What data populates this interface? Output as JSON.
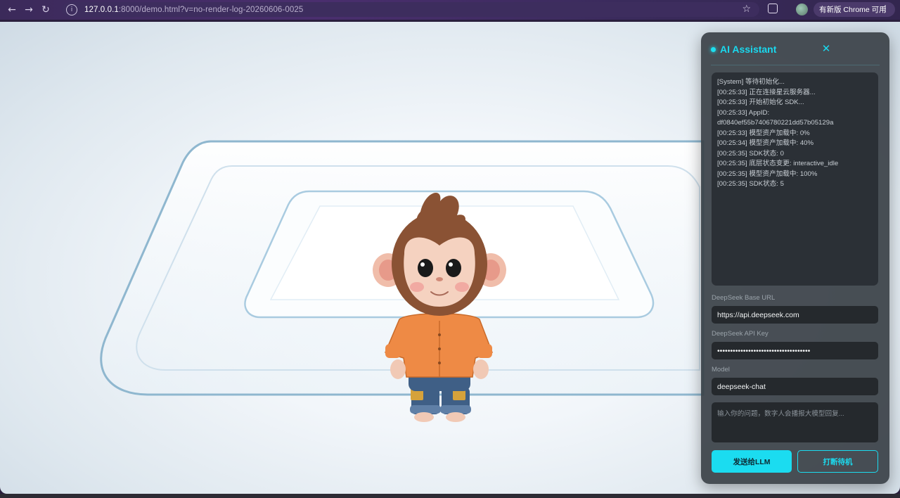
{
  "browser": {
    "url_host": "127.0.0.1",
    "url_rest": ":8000/demo.html?v=no-render-log-20260606-0025",
    "update_label": "有新版 Chrome 可用",
    "icons": {
      "back": "arrow-left-icon",
      "forward": "arrow-right-icon",
      "reload": "reload-icon",
      "info": "site-info-icon",
      "bookmark": "star-icon",
      "extensions": "puzzle-icon",
      "profile": "avatar",
      "menu": "more-vert-icon"
    }
  },
  "panel": {
    "title": "AI Assistant",
    "close_glyph": "✕",
    "log": [
      "[System] 等待初始化...",
      "[00:25:33] 正在连接星云服务器...",
      "[00:25:33] 开始初始化 SDK...",
      "[00:25:33] AppID:",
      "df0840ef55b7406780221dd57b05129a",
      "[00:25:33] 模型资产加载中: 0%",
      "[00:25:34] 模型资产加载中: 40%",
      "[00:25:35] SDK状态: 0",
      "[00:25:35] 底层状态变更: interactive_idle",
      "[00:25:35] 模型资产加载中: 100%",
      "[00:25:35] SDK状态: 5"
    ],
    "base_url_label": "DeepSeek Base URL",
    "base_url_value": "https://api.deepseek.com",
    "api_key_label": "DeepSeek API Key",
    "api_key_value": "••••••••••••••••••••••••••••••••••••",
    "model_label": "Model",
    "model_value": "deepseek-chat",
    "question_placeholder": "输入你的问题，数字人会播报大模型回复...",
    "send_label": "发送给LLM",
    "interrupt_label": "打断待机"
  },
  "colors": {
    "accent": "#1bdcf0",
    "panel_bg": "#3a4046",
    "browser_frame": "#3b2a5a"
  }
}
